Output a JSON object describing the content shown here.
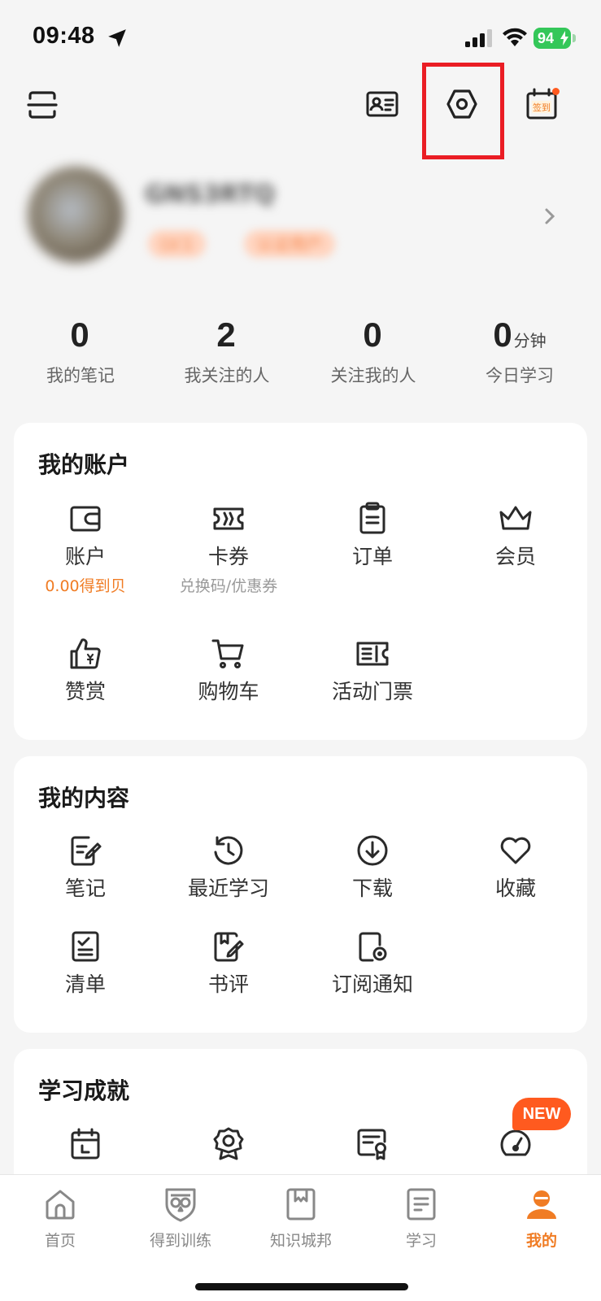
{
  "status_bar": {
    "time": "09:48",
    "battery": "94"
  },
  "profile": {
    "username": "GNS3RTQ",
    "badges": [
      "LV.1",
      "认证用户"
    ]
  },
  "stats": [
    {
      "value": "0",
      "unit": "",
      "label": "我的笔记"
    },
    {
      "value": "2",
      "unit": "",
      "label": "我关注的人"
    },
    {
      "value": "0",
      "unit": "",
      "label": "关注我的人"
    },
    {
      "value": "0",
      "unit": "分钟",
      "label": "今日学习"
    }
  ],
  "account": {
    "title": "我的账户",
    "items": [
      {
        "label": "账户",
        "sub": "0.00得到贝",
        "icon": "wallet-icon"
      },
      {
        "label": "卡券",
        "sub": "兑换码/优惠券",
        "icon": "ticket-icon"
      },
      {
        "label": "订单",
        "sub": "",
        "icon": "clipboard-icon"
      },
      {
        "label": "会员",
        "sub": "",
        "icon": "crown-icon"
      },
      {
        "label": "赞赏",
        "sub": "",
        "icon": "thumbs-up-icon"
      },
      {
        "label": "购物车",
        "sub": "",
        "icon": "cart-icon"
      },
      {
        "label": "活动门票",
        "sub": "",
        "icon": "event-ticket-icon"
      }
    ]
  },
  "content": {
    "title": "我的内容",
    "items": [
      {
        "label": "笔记",
        "icon": "note-edit-icon"
      },
      {
        "label": "最近学习",
        "icon": "history-icon"
      },
      {
        "label": "下载",
        "icon": "download-icon"
      },
      {
        "label": "收藏",
        "icon": "heart-icon"
      },
      {
        "label": "清单",
        "icon": "checklist-icon"
      },
      {
        "label": "书评",
        "icon": "book-review-icon"
      },
      {
        "label": "订阅通知",
        "icon": "subscription-bell-icon"
      }
    ]
  },
  "achievements": {
    "title": "学习成就",
    "new_badge": "NEW",
    "icons": [
      "calendar-icon",
      "medal-icon",
      "certificate-icon",
      "speedometer-icon"
    ]
  },
  "top_nav": {
    "signin_label": "签到"
  },
  "tabs": [
    {
      "label": "首页",
      "icon": "home-icon"
    },
    {
      "label": "得到训练",
      "icon": "owl-shield-icon"
    },
    {
      "label": "知识城邦",
      "icon": "bookmark-book-icon"
    },
    {
      "label": "学习",
      "icon": "document-icon"
    },
    {
      "label": "我的",
      "icon": "user-icon"
    }
  ],
  "colors": {
    "accent": "#f07c24",
    "highlight": "#ea1d24",
    "battery": "#34c759",
    "new_badge": "#ff5a1f"
  }
}
